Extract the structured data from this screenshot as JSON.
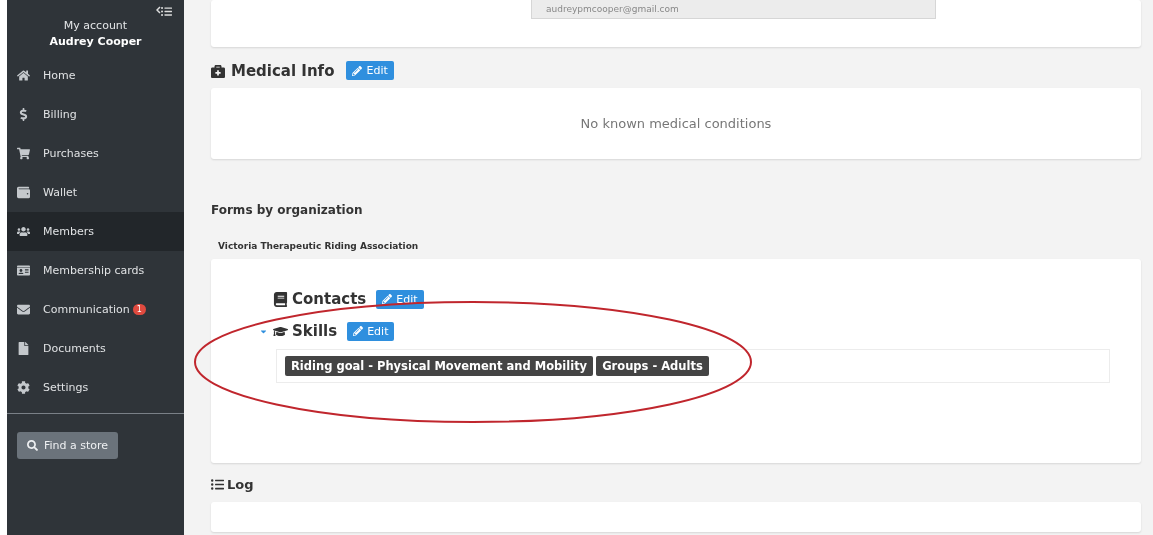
{
  "sidebar": {
    "account_label": "My account",
    "user_name": "Audrey Cooper",
    "items": [
      {
        "label": "Home",
        "selected": false
      },
      {
        "label": "Billing",
        "selected": false
      },
      {
        "label": "Purchases",
        "selected": false
      },
      {
        "label": "Wallet",
        "selected": false
      },
      {
        "label": "Members",
        "selected": true
      },
      {
        "label": "Membership cards",
        "selected": false
      },
      {
        "label": "Communication",
        "selected": false,
        "badge": "1"
      },
      {
        "label": "Documents",
        "selected": false
      },
      {
        "label": "Settings",
        "selected": false
      }
    ],
    "find_store_button": "Find a store"
  },
  "email_field": {
    "value": "audreypmcooper@gmail.com"
  },
  "medical_info": {
    "title": "Medical Info",
    "edit_button": "Edit",
    "message": "No known medical conditions"
  },
  "forms": {
    "title": "Forms by organization",
    "organization": "Victoria Therapeutic Riding Association",
    "sections": [
      {
        "title": "Contacts",
        "edit_button": "Edit",
        "expanded": false
      },
      {
        "title": "Skills",
        "edit_button": "Edit",
        "expanded": true,
        "tags": [
          "Riding goal - Physical Movement and Mobility",
          "Groups - Adults"
        ]
      }
    ]
  },
  "log": {
    "title": "Log"
  }
}
